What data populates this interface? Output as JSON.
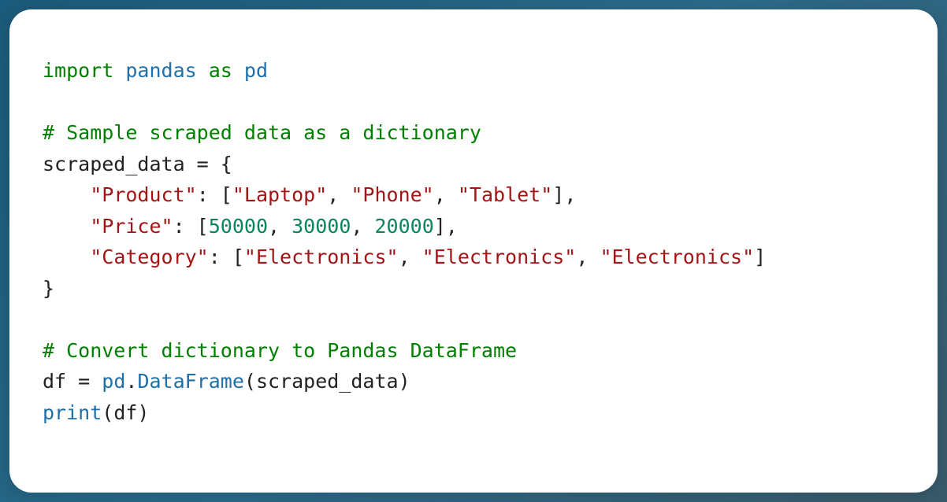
{
  "code": {
    "line1": {
      "kw1": "import",
      "mod": "pandas",
      "kw2": "as",
      "alias": "pd"
    },
    "line3": {
      "comment": "# Sample scraped data as a dictionary"
    },
    "line4": {
      "var": "scraped_data",
      "eq": " = {",
      "open": ""
    },
    "line5": {
      "indent": "    ",
      "key": "\"Product\"",
      "colon": ": [",
      "v1": "\"Laptop\"",
      "c1": ", ",
      "v2": "\"Phone\"",
      "c2": ", ",
      "v3": "\"Tablet\"",
      "close": "],"
    },
    "line6": {
      "indent": "    ",
      "key": "\"Price\"",
      "colon": ": [",
      "v1": "50000",
      "c1": ", ",
      "v2": "30000",
      "c2": ", ",
      "v3": "20000",
      "close": "],"
    },
    "line7": {
      "indent": "    ",
      "key": "\"Category\"",
      "colon": ": [",
      "v1": "\"Electronics\"",
      "c1": ", ",
      "v2": "\"Electronics\"",
      "c2": ", ",
      "v3": "\"Electronics\"",
      "close": "]"
    },
    "line8": {
      "close": "}"
    },
    "line10": {
      "comment": "# Convert dictionary to Pandas DataFrame"
    },
    "line11": {
      "var": "df",
      "eq": " = ",
      "mod": "pd",
      "dot": ".",
      "fn": "DataFrame",
      "args": "(scraped_data)"
    },
    "line12": {
      "fn": "print",
      "args": "(df)"
    }
  }
}
